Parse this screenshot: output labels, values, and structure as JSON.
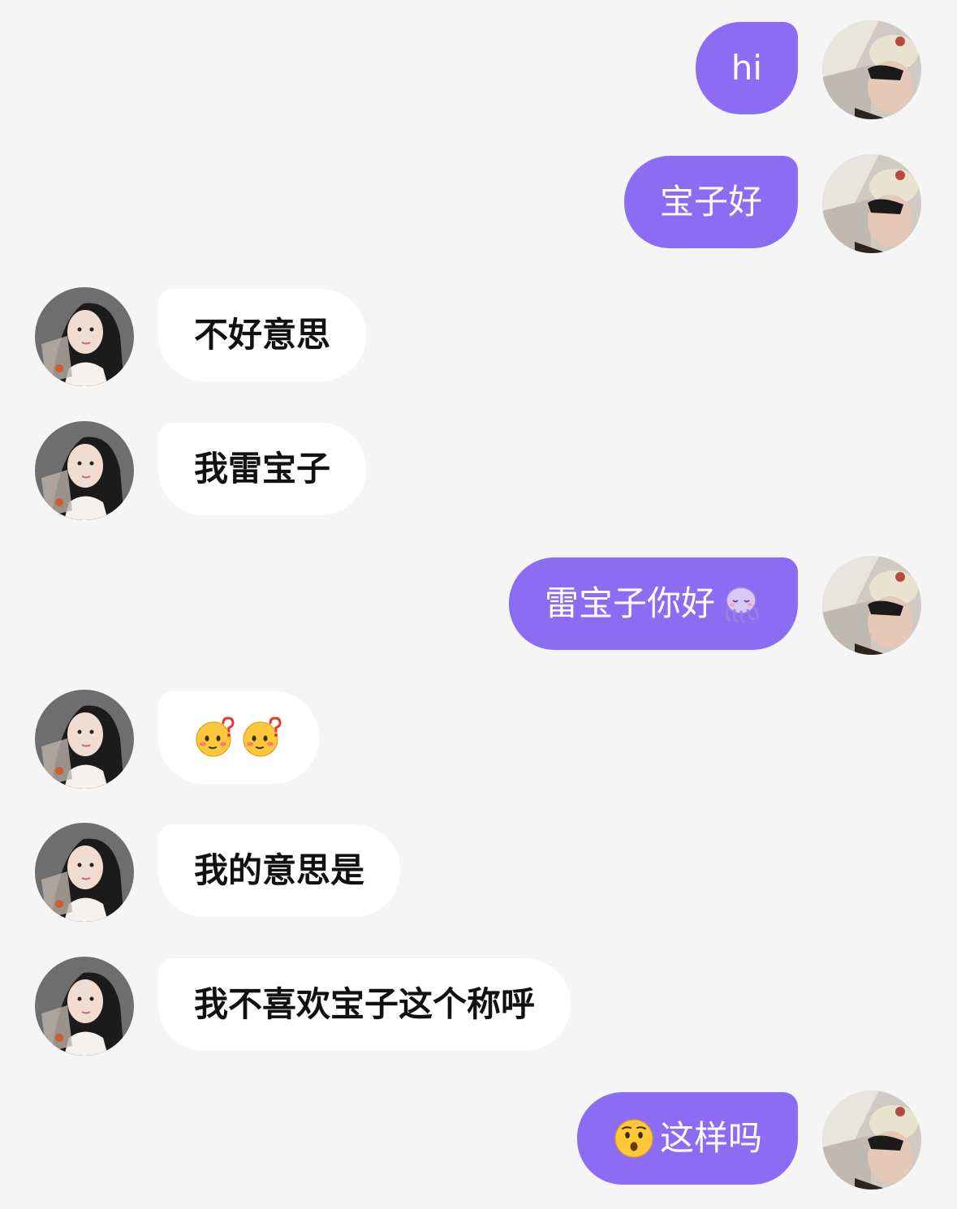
{
  "messages": [
    {
      "sender": "me",
      "text": "hi"
    },
    {
      "sender": "me",
      "text": "宝子好"
    },
    {
      "sender": "them",
      "text": "不好意思"
    },
    {
      "sender": "them",
      "text": "我雷宝子"
    },
    {
      "sender": "me",
      "text": "雷宝子你好",
      "emoji_after": "octopus-emoji"
    },
    {
      "sender": "them",
      "text": "",
      "emojis": [
        "confused-face-emoji",
        "confused-face-emoji"
      ]
    },
    {
      "sender": "them",
      "text": "我的意思是"
    },
    {
      "sender": "them",
      "text": "我不喜欢宝子这个称呼"
    },
    {
      "sender": "me",
      "text": "这样吗",
      "emoji_before": "surprised-face-emoji"
    }
  ],
  "colors": {
    "background": "#f5f5f5",
    "my_bubble": "#8c6cf2",
    "their_bubble": "#ffffff"
  }
}
